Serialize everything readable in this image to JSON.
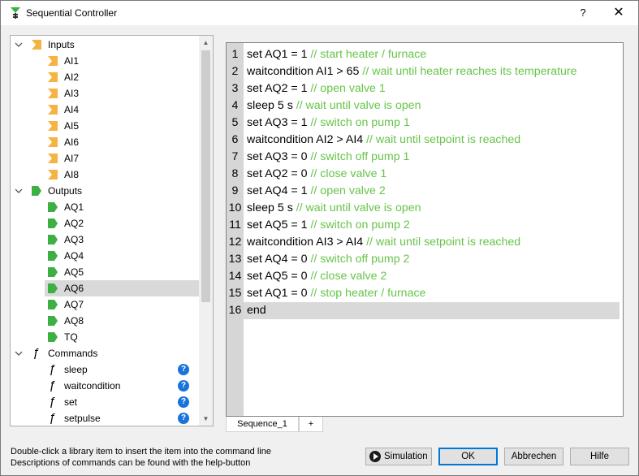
{
  "window": {
    "title": "Sequential Controller",
    "help_glyph": "?",
    "close_glyph": "✕"
  },
  "colors": {
    "input_icon": "#f5b342",
    "output_icon": "#3cb043",
    "comment": "#67c44a",
    "help_badge": "#1a73d9",
    "selection": "#d9d9d9",
    "gutter": "#d6d6d6"
  },
  "tree": {
    "groups": [
      {
        "label": "Inputs",
        "icon": "input-tag-icon",
        "items": [
          "AI1",
          "AI2",
          "AI3",
          "AI4",
          "AI5",
          "AI6",
          "AI7",
          "AI8"
        ]
      },
      {
        "label": "Outputs",
        "icon": "output-tag-icon",
        "items": [
          "AQ1",
          "AQ2",
          "AQ3",
          "AQ4",
          "AQ5",
          "AQ6",
          "AQ7",
          "AQ8",
          "TQ"
        ],
        "selected": "AQ6"
      },
      {
        "label": "Commands",
        "icon": "function-icon",
        "items": [
          "sleep",
          "waitcondition",
          "set",
          "setpulse"
        ]
      }
    ],
    "help_glyph": "?",
    "function_glyph": "ƒ"
  },
  "editor": {
    "lines": [
      {
        "n": "1",
        "code": "set AQ1 = 1 ",
        "comment": "// start heater / furnace"
      },
      {
        "n": "2",
        "code": "waitcondition AI1 > 65 ",
        "comment": "// wait until heater reaches its temperature"
      },
      {
        "n": "3",
        "code": "set AQ2 = 1 ",
        "comment": "// open valve 1"
      },
      {
        "n": "4",
        "code": "sleep 5 s ",
        "comment": "// wait until valve is open"
      },
      {
        "n": "5",
        "code": "set AQ3 = 1 ",
        "comment": "// switch on pump 1"
      },
      {
        "n": "6",
        "code": "waitcondition AI2 > AI4 ",
        "comment": "// wait until setpoint is reached"
      },
      {
        "n": "7",
        "code": "set AQ3 = 0 ",
        "comment": "// switch off pump 1"
      },
      {
        "n": "8",
        "code": "set AQ2 = 0 ",
        "comment": "// close valve 1"
      },
      {
        "n": "9",
        "code": "set AQ4 = 1 ",
        "comment": "// open valve 2"
      },
      {
        "n": "10",
        "code": "sleep 5 s ",
        "comment": "// wait until valve is open"
      },
      {
        "n": "11",
        "code": "set AQ5 = 1 ",
        "comment": "// switch on pump 2"
      },
      {
        "n": "12",
        "code": "waitcondition AI3 > AI4 ",
        "comment": "// wait until setpoint is reached"
      },
      {
        "n": "13",
        "code": "set AQ4 = 0 ",
        "comment": "// switch off pump 2"
      },
      {
        "n": "14",
        "code": "set AQ5 = 0 ",
        "comment": "// close valve 2"
      },
      {
        "n": "15",
        "code": "set AQ1 = 0 ",
        "comment": "// stop heater / furnace"
      },
      {
        "n": "16",
        "code": "end",
        "comment": "",
        "current": true
      }
    ]
  },
  "tabs": {
    "sequence": "Sequence_1",
    "add": "+"
  },
  "hints": {
    "line1": "Double-click a library item to insert the item into the command line",
    "line2": "Descriptions of commands can be found with the help-button"
  },
  "buttons": {
    "simulation": "Simulation",
    "ok": "OK",
    "cancel": "Abbrechen",
    "help": "Hilfe"
  }
}
